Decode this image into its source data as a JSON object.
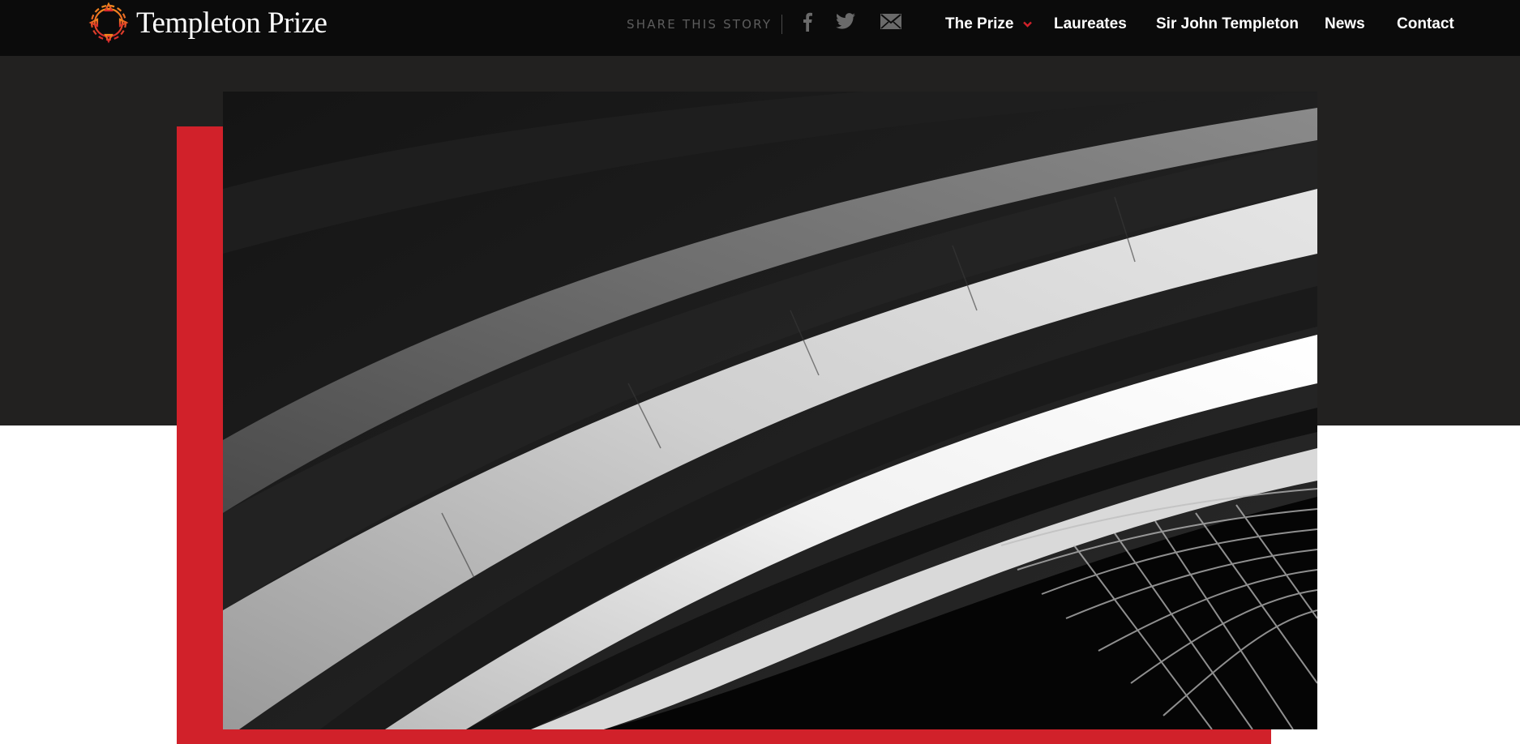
{
  "header": {
    "logo_text": "Templeton Prize",
    "share_label": "SHARE THIS STORY",
    "social": [
      {
        "name": "facebook",
        "icon": "facebook-icon"
      },
      {
        "name": "twitter",
        "icon": "twitter-icon"
      },
      {
        "name": "email",
        "icon": "mail-icon"
      }
    ],
    "nav": [
      {
        "label": "The Prize",
        "has_dropdown": true
      },
      {
        "label": "Laureates"
      },
      {
        "label": "Sir John Templeton"
      },
      {
        "label": "News"
      },
      {
        "label": "Contact"
      }
    ]
  },
  "colors": {
    "header_bg": "#0b0b0b",
    "hero_band": "#222120",
    "accent_red": "#d1212a",
    "caret": "#d1212a",
    "share_text": "#5d5d5d"
  },
  "hero": {
    "image": "black-and-white architectural arches photo"
  }
}
